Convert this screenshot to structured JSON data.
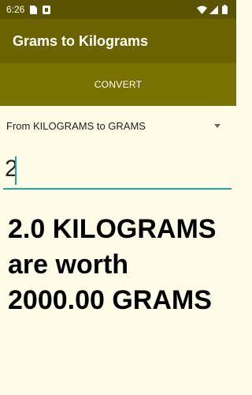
{
  "status_bar": {
    "time": "6:26",
    "icons": [
      "sim-card-icon",
      "app-notification-icon",
      "wifi-icon",
      "signal-icon",
      "battery-icon"
    ]
  },
  "app_bar": {
    "title": "Grams to Kilograms"
  },
  "convert_button": {
    "label": "CONVERT"
  },
  "spinner": {
    "selected": "From KILOGRAMS to GRAMS"
  },
  "input": {
    "value": "2"
  },
  "result": {
    "line1": "2.0 KILOGRAMS",
    "line2": "are worth",
    "line3": "2000.00 GRAMS"
  },
  "colors": {
    "status_bar": "#5b5300",
    "app_bar": "#6b6300",
    "convert_bar": "#7a7200",
    "background": "#fffde7",
    "accent": "#26a69a"
  }
}
